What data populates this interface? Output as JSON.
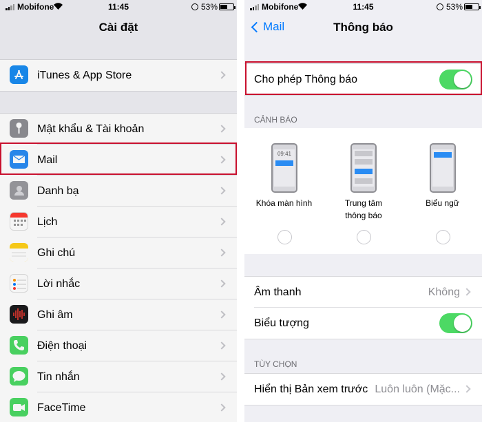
{
  "left": {
    "status": {
      "carrier": "Mobifone",
      "time": "11:45",
      "battery": "53%"
    },
    "nav_title": "Cài đặt",
    "group1": [
      {
        "id": "itunes",
        "label": "iTunes & App Store",
        "icon": "app-store-icon",
        "color": "#1a8cf1"
      }
    ],
    "group2": [
      {
        "id": "passwords",
        "label": "Mật khẩu & Tài khoản",
        "icon": "key-icon",
        "color": "#8e8e93"
      },
      {
        "id": "mail",
        "label": "Mail",
        "icon": "mail-icon",
        "color": "#2a8cf3"
      },
      {
        "id": "contacts",
        "label": "Danh bạ",
        "icon": "contacts-icon",
        "color": "#9a9a9f"
      },
      {
        "id": "calendar",
        "label": "Lịch",
        "icon": "calendar-icon",
        "color": "#ffffff"
      },
      {
        "id": "notes",
        "label": "Ghi chú",
        "icon": "notes-icon",
        "color": "#ffd11a"
      },
      {
        "id": "reminders",
        "label": "Lời nhắc",
        "icon": "reminders-icon",
        "color": "#ffffff"
      },
      {
        "id": "voice",
        "label": "Ghi âm",
        "icon": "voice-memo-icon",
        "color": "#1c1c1e"
      },
      {
        "id": "phone",
        "label": "Điện thoại",
        "icon": "phone-icon",
        "color": "#4cd964"
      },
      {
        "id": "messages",
        "label": "Tin nhắn",
        "icon": "messages-icon",
        "color": "#4cd964"
      },
      {
        "id": "facetime",
        "label": "FaceTime",
        "icon": "facetime-icon",
        "color": "#4cd964"
      }
    ]
  },
  "right": {
    "status": {
      "carrier": "Mobifone",
      "time": "11:45",
      "battery": "53%"
    },
    "back_label": "Mail",
    "nav_title": "Thông báo",
    "allow_label": "Cho phép Thông báo",
    "allow_on": true,
    "alerts_header": "CẢNH BÁO",
    "alerts": [
      {
        "id": "lock",
        "label": "Khóa màn hình",
        "time_text": "09:41"
      },
      {
        "id": "center",
        "label": "Trung tâm\nthông báo"
      },
      {
        "id": "banner",
        "label": "Biểu ngữ"
      }
    ],
    "sound_label": "Âm thanh",
    "sound_value": "Không",
    "badge_label": "Biểu tượng",
    "badge_on": true,
    "options_header": "TÙY CHỌN",
    "preview_label": "Hiển thị Bản xem trước",
    "preview_value": "Luôn luôn (Mặc..."
  },
  "colors": {
    "accent": "#007aff",
    "toggle_on": "#4cd964",
    "highlight": "#c8102e"
  }
}
